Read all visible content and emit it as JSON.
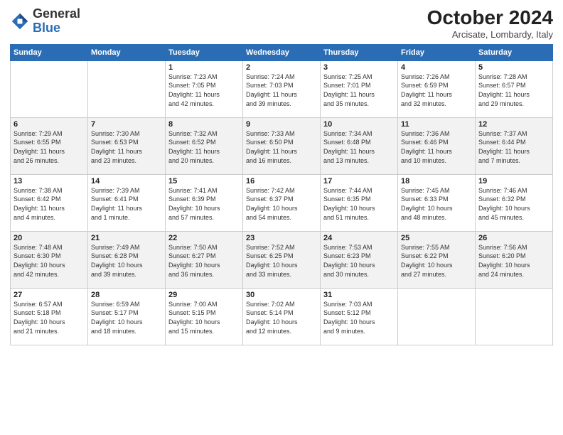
{
  "header": {
    "logo_general": "General",
    "logo_blue": "Blue",
    "month_title": "October 2024",
    "subtitle": "Arcisate, Lombardy, Italy"
  },
  "weekdays": [
    "Sunday",
    "Monday",
    "Tuesday",
    "Wednesday",
    "Thursday",
    "Friday",
    "Saturday"
  ],
  "weeks": [
    [
      {
        "day": "",
        "detail": ""
      },
      {
        "day": "",
        "detail": ""
      },
      {
        "day": "1",
        "detail": "Sunrise: 7:23 AM\nSunset: 7:05 PM\nDaylight: 11 hours\nand 42 minutes."
      },
      {
        "day": "2",
        "detail": "Sunrise: 7:24 AM\nSunset: 7:03 PM\nDaylight: 11 hours\nand 39 minutes."
      },
      {
        "day": "3",
        "detail": "Sunrise: 7:25 AM\nSunset: 7:01 PM\nDaylight: 11 hours\nand 35 minutes."
      },
      {
        "day": "4",
        "detail": "Sunrise: 7:26 AM\nSunset: 6:59 PM\nDaylight: 11 hours\nand 32 minutes."
      },
      {
        "day": "5",
        "detail": "Sunrise: 7:28 AM\nSunset: 6:57 PM\nDaylight: 11 hours\nand 29 minutes."
      }
    ],
    [
      {
        "day": "6",
        "detail": "Sunrise: 7:29 AM\nSunset: 6:55 PM\nDaylight: 11 hours\nand 26 minutes."
      },
      {
        "day": "7",
        "detail": "Sunrise: 7:30 AM\nSunset: 6:53 PM\nDaylight: 11 hours\nand 23 minutes."
      },
      {
        "day": "8",
        "detail": "Sunrise: 7:32 AM\nSunset: 6:52 PM\nDaylight: 11 hours\nand 20 minutes."
      },
      {
        "day": "9",
        "detail": "Sunrise: 7:33 AM\nSunset: 6:50 PM\nDaylight: 11 hours\nand 16 minutes."
      },
      {
        "day": "10",
        "detail": "Sunrise: 7:34 AM\nSunset: 6:48 PM\nDaylight: 11 hours\nand 13 minutes."
      },
      {
        "day": "11",
        "detail": "Sunrise: 7:36 AM\nSunset: 6:46 PM\nDaylight: 11 hours\nand 10 minutes."
      },
      {
        "day": "12",
        "detail": "Sunrise: 7:37 AM\nSunset: 6:44 PM\nDaylight: 11 hours\nand 7 minutes."
      }
    ],
    [
      {
        "day": "13",
        "detail": "Sunrise: 7:38 AM\nSunset: 6:42 PM\nDaylight: 11 hours\nand 4 minutes."
      },
      {
        "day": "14",
        "detail": "Sunrise: 7:39 AM\nSunset: 6:41 PM\nDaylight: 11 hours\nand 1 minute."
      },
      {
        "day": "15",
        "detail": "Sunrise: 7:41 AM\nSunset: 6:39 PM\nDaylight: 10 hours\nand 57 minutes."
      },
      {
        "day": "16",
        "detail": "Sunrise: 7:42 AM\nSunset: 6:37 PM\nDaylight: 10 hours\nand 54 minutes."
      },
      {
        "day": "17",
        "detail": "Sunrise: 7:44 AM\nSunset: 6:35 PM\nDaylight: 10 hours\nand 51 minutes."
      },
      {
        "day": "18",
        "detail": "Sunrise: 7:45 AM\nSunset: 6:33 PM\nDaylight: 10 hours\nand 48 minutes."
      },
      {
        "day": "19",
        "detail": "Sunrise: 7:46 AM\nSunset: 6:32 PM\nDaylight: 10 hours\nand 45 minutes."
      }
    ],
    [
      {
        "day": "20",
        "detail": "Sunrise: 7:48 AM\nSunset: 6:30 PM\nDaylight: 10 hours\nand 42 minutes."
      },
      {
        "day": "21",
        "detail": "Sunrise: 7:49 AM\nSunset: 6:28 PM\nDaylight: 10 hours\nand 39 minutes."
      },
      {
        "day": "22",
        "detail": "Sunrise: 7:50 AM\nSunset: 6:27 PM\nDaylight: 10 hours\nand 36 minutes."
      },
      {
        "day": "23",
        "detail": "Sunrise: 7:52 AM\nSunset: 6:25 PM\nDaylight: 10 hours\nand 33 minutes."
      },
      {
        "day": "24",
        "detail": "Sunrise: 7:53 AM\nSunset: 6:23 PM\nDaylight: 10 hours\nand 30 minutes."
      },
      {
        "day": "25",
        "detail": "Sunrise: 7:55 AM\nSunset: 6:22 PM\nDaylight: 10 hours\nand 27 minutes."
      },
      {
        "day": "26",
        "detail": "Sunrise: 7:56 AM\nSunset: 6:20 PM\nDaylight: 10 hours\nand 24 minutes."
      }
    ],
    [
      {
        "day": "27",
        "detail": "Sunrise: 6:57 AM\nSunset: 5:18 PM\nDaylight: 10 hours\nand 21 minutes."
      },
      {
        "day": "28",
        "detail": "Sunrise: 6:59 AM\nSunset: 5:17 PM\nDaylight: 10 hours\nand 18 minutes."
      },
      {
        "day": "29",
        "detail": "Sunrise: 7:00 AM\nSunset: 5:15 PM\nDaylight: 10 hours\nand 15 minutes."
      },
      {
        "day": "30",
        "detail": "Sunrise: 7:02 AM\nSunset: 5:14 PM\nDaylight: 10 hours\nand 12 minutes."
      },
      {
        "day": "31",
        "detail": "Sunrise: 7:03 AM\nSunset: 5:12 PM\nDaylight: 10 hours\nand 9 minutes."
      },
      {
        "day": "",
        "detail": ""
      },
      {
        "day": "",
        "detail": ""
      }
    ]
  ]
}
